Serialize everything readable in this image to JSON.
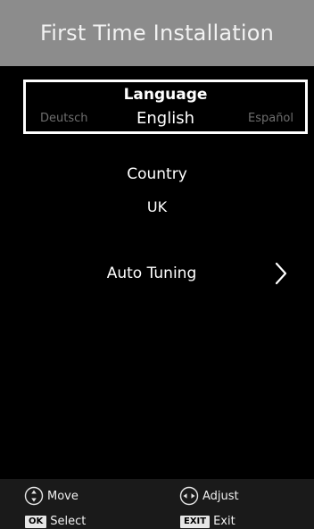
{
  "header": {
    "title": "First Time Installation"
  },
  "language": {
    "label": "Language",
    "previous": "Deutsch",
    "selected": "English",
    "next": "Español"
  },
  "country": {
    "label": "Country",
    "value": "UK"
  },
  "auto_tuning": {
    "label": "Auto Tuning"
  },
  "footer": {
    "move_label": "Move",
    "adjust_label": "Adjust",
    "ok_key": "OK",
    "select_label": "Select",
    "exit_key": "EXIT",
    "exit_label": "Exit"
  },
  "colors": {
    "header_bg": "#8c8c8c",
    "body_bg": "#000000",
    "footer_bg": "#1a1a1a",
    "inactive_option": "#6e6e6e",
    "text": "#ffffff"
  }
}
